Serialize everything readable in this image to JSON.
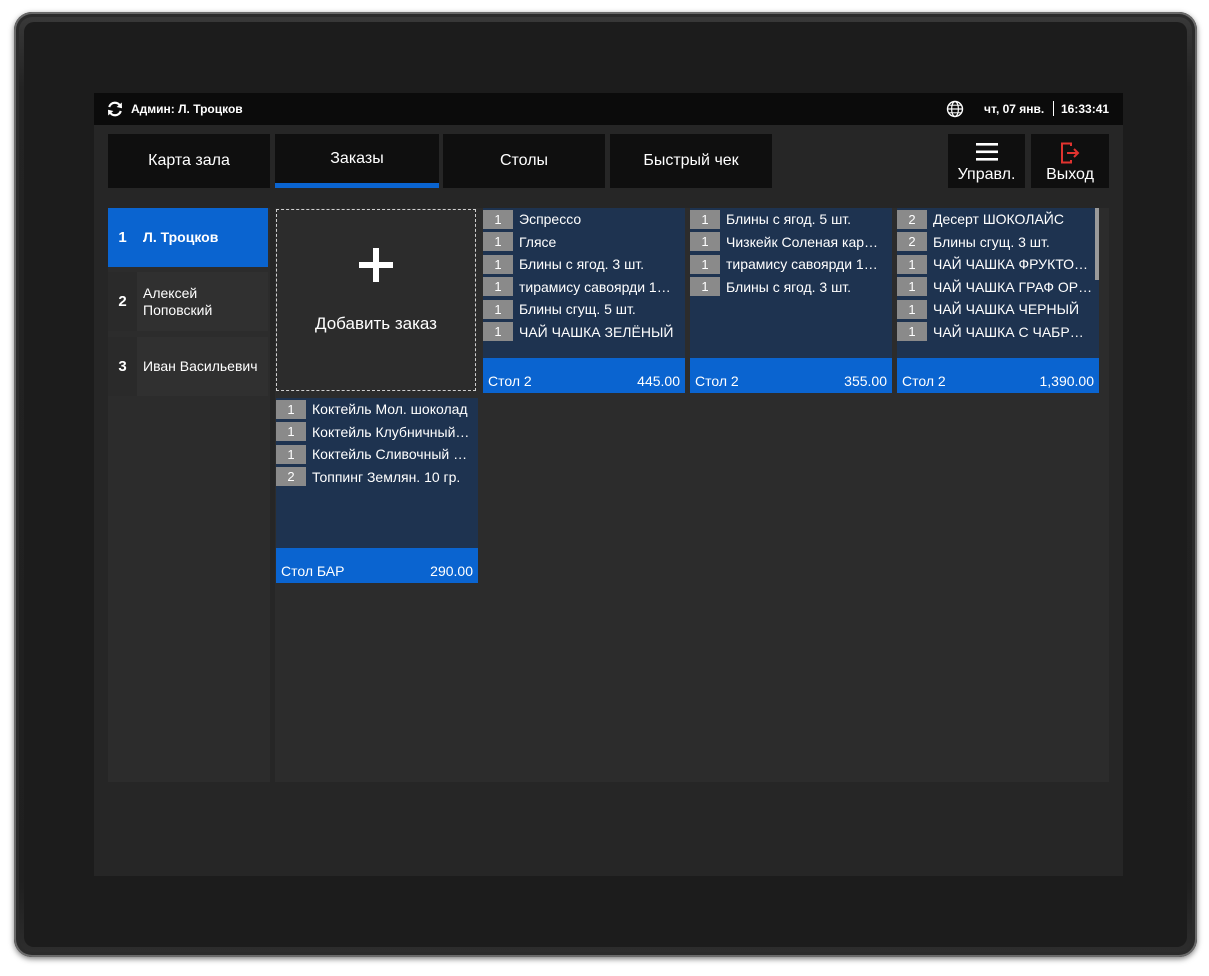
{
  "statusbar": {
    "admin": "Админ: Л. Троцков",
    "date": "чт, 07 янв.",
    "time": "16:33:41"
  },
  "tabs": [
    {
      "label": "Карта зала",
      "active": false
    },
    {
      "label": "Заказы",
      "active": true
    },
    {
      "label": "Столы",
      "active": false
    },
    {
      "label": "Быстрый чек",
      "active": false
    }
  ],
  "tools": {
    "manage_label": "Управл.",
    "exit_label": "Выход"
  },
  "colors": {
    "accent": "#0a64d0",
    "exit_icon": "#e0332f",
    "card_bg": "#1e3350"
  },
  "waiters": [
    {
      "num": "1",
      "name": "Л. Троцков",
      "active": true
    },
    {
      "num": "2",
      "name": "Алексей Поповский",
      "active": false
    },
    {
      "num": "3",
      "name": "Иван Васильевич",
      "active": false
    }
  ],
  "add_order": {
    "label": "Добавить заказ"
  },
  "orders": [
    {
      "items": [
        {
          "qty": "1",
          "name": "Эспрессо"
        },
        {
          "qty": "1",
          "name": "Глясе"
        },
        {
          "qty": "1",
          "name": "Блины с ягод. 3 шт."
        },
        {
          "qty": "1",
          "name": "тирамису савоярди 1…"
        },
        {
          "qty": "1",
          "name": "Блины сгущ. 5 шт."
        },
        {
          "qty": "1",
          "name": "ЧАЙ ЧАШКА ЗЕЛЁНЫЙ"
        }
      ],
      "table": "Стол 2",
      "total": "445.00"
    },
    {
      "items": [
        {
          "qty": "1",
          "name": "Блины с ягод. 5 шт."
        },
        {
          "qty": "1",
          "name": "Чизкейк Соленая кар…"
        },
        {
          "qty": "1",
          "name": "тирамису савоярди 1…"
        },
        {
          "qty": "1",
          "name": "Блины с ягод. 3 шт."
        }
      ],
      "table": "Стол 2",
      "total": "355.00"
    },
    {
      "items": [
        {
          "qty": "2",
          "name": "Десерт ШОКОЛАЙС"
        },
        {
          "qty": "2",
          "name": "Блины сгущ. 3 шт."
        },
        {
          "qty": "1",
          "name": "ЧАЙ ЧАШКА ФРУКТО…"
        },
        {
          "qty": "1",
          "name": "ЧАЙ ЧАШКА ГРАФ ОР…"
        },
        {
          "qty": "1",
          "name": "ЧАЙ ЧАШКА ЧЕРНЫЙ"
        },
        {
          "qty": "1",
          "name": "ЧАЙ ЧАШКА С ЧАБР…"
        }
      ],
      "table": "Стол 2",
      "total": "1,390.00"
    },
    {
      "items": [
        {
          "qty": "1",
          "name": "Коктейль Мол. шоколад"
        },
        {
          "qty": "1",
          "name": "Коктейль Клубничный…"
        },
        {
          "qty": "1",
          "name": "Коктейль Сливочный …"
        },
        {
          "qty": "2",
          "name": "Топпинг Землян. 10 гр."
        }
      ],
      "table": "Стол БАР",
      "total": "290.00"
    }
  ]
}
